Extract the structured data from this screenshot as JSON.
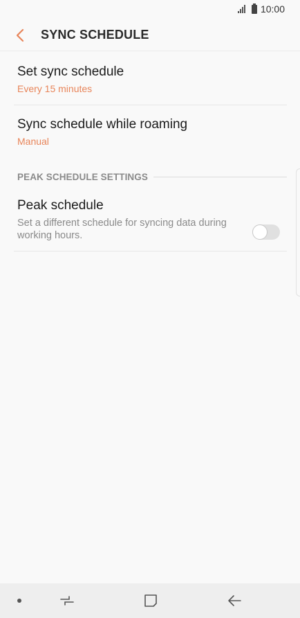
{
  "status_bar": {
    "time": "10:00"
  },
  "header": {
    "title": "SYNC SCHEDULE",
    "back_icon": "chevron-left-icon"
  },
  "settings": {
    "sync_schedule": {
      "title": "Set sync schedule",
      "value": "Every 15 minutes"
    },
    "roaming": {
      "title": "Sync schedule while roaming",
      "value": "Manual"
    }
  },
  "section": {
    "label": "PEAK SCHEDULE SETTINGS"
  },
  "peak": {
    "title": "Peak schedule",
    "description": "Set a different schedule for syncing data during working hours.",
    "enabled": false
  },
  "nav_bar": {
    "icons": [
      "dot-icon",
      "recent-apps-icon",
      "home-icon",
      "back-arrow-icon"
    ]
  },
  "colors": {
    "accent": "#e8855a",
    "background": "#f9f9f9",
    "nav_background": "#eeeeee"
  }
}
